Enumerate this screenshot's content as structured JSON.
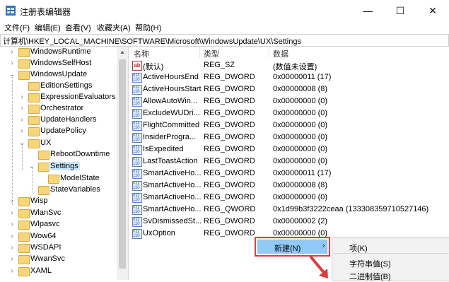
{
  "window": {
    "title": "注册表编辑器",
    "minimize": "—",
    "maximize": "☐",
    "close": "✕"
  },
  "menu": [
    "文件(F)",
    "编辑(E)",
    "查看(V)",
    "收藏夹(A)",
    "帮助(H)"
  ],
  "address": "计算机\\HKEY_LOCAL_MACHINE\\SOFTWARE\\Microsoft\\WindowsUpdate\\UX\\Settings",
  "tree": [
    {
      "label": "WindowsRuntime",
      "chev": "›"
    },
    {
      "label": "WindowsSelfHost",
      "chev": "›"
    },
    {
      "label": "WindowsUpdate",
      "chev": "⌄"
    },
    {
      "label": "EditionSettings",
      "chev": ""
    },
    {
      "label": "ExpressionEvaluators",
      "chev": "›"
    },
    {
      "label": "Orchestrator",
      "chev": "›"
    },
    {
      "label": "UpdateHandlers",
      "chev": "›"
    },
    {
      "label": "UpdatePolicy",
      "chev": "›"
    },
    {
      "label": "UX",
      "chev": "⌄"
    },
    {
      "label": "RebootDowntime",
      "chev": ""
    },
    {
      "label": "Settings",
      "chev": "⌄"
    },
    {
      "label": "ModelState",
      "chev": ""
    },
    {
      "label": "StateVariables",
      "chev": ""
    },
    {
      "label": "Wisp",
      "chev": "›"
    },
    {
      "label": "WlanSvc",
      "chev": "›"
    },
    {
      "label": "Wlpasvc",
      "chev": "›"
    },
    {
      "label": "Wow64",
      "chev": "›"
    },
    {
      "label": "WSDAPI",
      "chev": "›"
    },
    {
      "label": "WwanSvc",
      "chev": "›"
    },
    {
      "label": "XAML",
      "chev": "›"
    }
  ],
  "columns": {
    "name": "名称",
    "type": "类型",
    "data": "数据"
  },
  "values": [
    {
      "name": "(默认)",
      "type": "REG_SZ",
      "data": "(数值未设置)",
      "icon": "ab"
    },
    {
      "name": "ActiveHoursEnd",
      "type": "REG_DWORD",
      "data": "0x00000011 (17)",
      "icon": "011"
    },
    {
      "name": "ActiveHoursStart",
      "type": "REG_DWORD",
      "data": "0x00000008 (8)",
      "icon": "011"
    },
    {
      "name": "AllowAutoWin...",
      "type": "REG_DWORD",
      "data": "0x00000000 (0)",
      "icon": "011"
    },
    {
      "name": "ExcludeWUDri...",
      "type": "REG_DWORD",
      "data": "0x00000000 (0)",
      "icon": "011"
    },
    {
      "name": "FlightCommitted",
      "type": "REG_DWORD",
      "data": "0x00000000 (0)",
      "icon": "011"
    },
    {
      "name": "InsiderProgra...",
      "type": "REG_DWORD",
      "data": "0x00000000 (0)",
      "icon": "011"
    },
    {
      "name": "IsExpedited",
      "type": "REG_DWORD",
      "data": "0x00000000 (0)",
      "icon": "011"
    },
    {
      "name": "LastToastAction",
      "type": "REG_DWORD",
      "data": "0x00000000 (0)",
      "icon": "011"
    },
    {
      "name": "SmartActiveHo...",
      "type": "REG_DWORD",
      "data": "0x00000011 (17)",
      "icon": "011"
    },
    {
      "name": "SmartActiveHo...",
      "type": "REG_DWORD",
      "data": "0x00000008 (8)",
      "icon": "011"
    },
    {
      "name": "SmartActiveHo...",
      "type": "REG_DWORD",
      "data": "0x00000000 (0)",
      "icon": "011"
    },
    {
      "name": "SmartActiveHo...",
      "type": "REG_QWORD",
      "data": "0x1d99b3f3222ceaa (133308359710527146)",
      "icon": "011"
    },
    {
      "name": "SvDismissedSt...",
      "type": "REG_DWORD",
      "data": "0x00000002 (2)",
      "icon": "011"
    },
    {
      "name": "UxOption",
      "type": "REG_DWORD",
      "data": "0x00000000 (0)",
      "icon": "011"
    }
  ],
  "context_menu": {
    "new_label": "新建(N)",
    "arrow": "›"
  },
  "submenu": {
    "items": [
      "项(K)",
      "字符串值(S)",
      "二进制值(B)"
    ]
  },
  "colors": {
    "highlight": "#91c9f7",
    "annotation_red": "#e23a3a",
    "selection": "#cce8ff"
  }
}
